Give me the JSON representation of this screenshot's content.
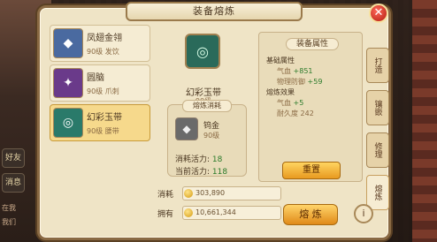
{
  "window": {
    "title": "装备熔炼",
    "close_symbol": "✕"
  },
  "items": [
    {
      "name": "凤翅金翎",
      "level": "90级",
      "type": "发饮",
      "icon": "gear-icon"
    },
    {
      "name": "圆脑",
      "level": "90级",
      "type": "爪刺",
      "icon": "gear-icon"
    },
    {
      "name": "幻彩玉带",
      "level": "90级",
      "type": "腰带",
      "icon": "gear-icon"
    }
  ],
  "selected_item": {
    "name": "幻彩玉带",
    "level": "90级"
  },
  "consume": {
    "title": "熔炼消耗",
    "material_name": "钨金",
    "material_level": "90级",
    "stamina_cost_label": "消耗活力:",
    "stamina_cost_value": "18",
    "stamina_current_label": "当前活力:",
    "stamina_current_value": "118"
  },
  "attributes": {
    "title": "装备属性",
    "base_label": "基础属性",
    "base_rows": [
      {
        "name": "气血",
        "value": "+851"
      },
      {
        "name": "物理防御",
        "value": "+59"
      }
    ],
    "smelt_label": "熔炼效果",
    "smelt_rows": [
      {
        "name": "气血",
        "value": "+5"
      }
    ],
    "durability_label": "耐久度",
    "durability_value": "242",
    "reset_label": "重置"
  },
  "tabs": [
    "打造",
    "镶嵌",
    "修理",
    "熔炼"
  ],
  "active_tab": "熔炼",
  "bottom": {
    "consume_label": "消耗",
    "consume_value": "303,890",
    "own_label": "拥有",
    "own_value": "10,661,344",
    "smelt_button": "熔 炼",
    "info_symbol": "i",
    "plus_symbol": "+"
  },
  "left_overlay": {
    "side_labels": [
      "好友",
      "消息"
    ],
    "text_1": "在我",
    "text_2": "我们"
  }
}
